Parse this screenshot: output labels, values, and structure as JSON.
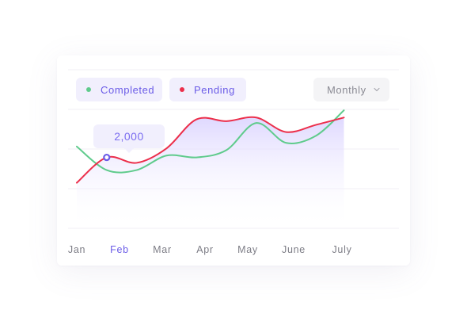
{
  "legend": {
    "completed_label": "Completed",
    "pending_label": "Pending"
  },
  "period_select": {
    "value": "Monthly"
  },
  "tooltip": {
    "value": "2,000"
  },
  "colors": {
    "completed": "#5fcb8c",
    "pending": "#ec2f4b",
    "accent": "#6b5ce7",
    "area_fill": "#e6e0ff"
  },
  "chart_data": {
    "type": "line",
    "title": "",
    "xlabel": "",
    "ylabel": "",
    "categories": [
      "Jan",
      "Feb",
      "Mar",
      "Apr",
      "May",
      "June",
      "July"
    ],
    "selected_category": "Feb",
    "ylim": [
      0,
      3500
    ],
    "grid": true,
    "legend_position": "top-left",
    "series": [
      {
        "name": "Completed",
        "key": "completed",
        "x": [
          0.5,
          1.2,
          1.9,
          2.6,
          3.3,
          4.0,
          4.7,
          5.4,
          6.1,
          6.75
        ],
        "values": [
          2300,
          1650,
          1650,
          2050,
          2000,
          2200,
          2950,
          2400,
          2600,
          3300
        ]
      },
      {
        "name": "Pending",
        "key": "pending",
        "x": [
          0.5,
          1.2,
          1.9,
          2.6,
          3.3,
          4.0,
          4.7,
          5.4,
          6.1,
          6.75
        ],
        "values": [
          1300,
          2000,
          1850,
          2250,
          3050,
          3000,
          3100,
          2700,
          2900,
          3100
        ]
      }
    ],
    "highlight": {
      "series": "Pending",
      "x": 1.2,
      "value": 2000
    }
  }
}
